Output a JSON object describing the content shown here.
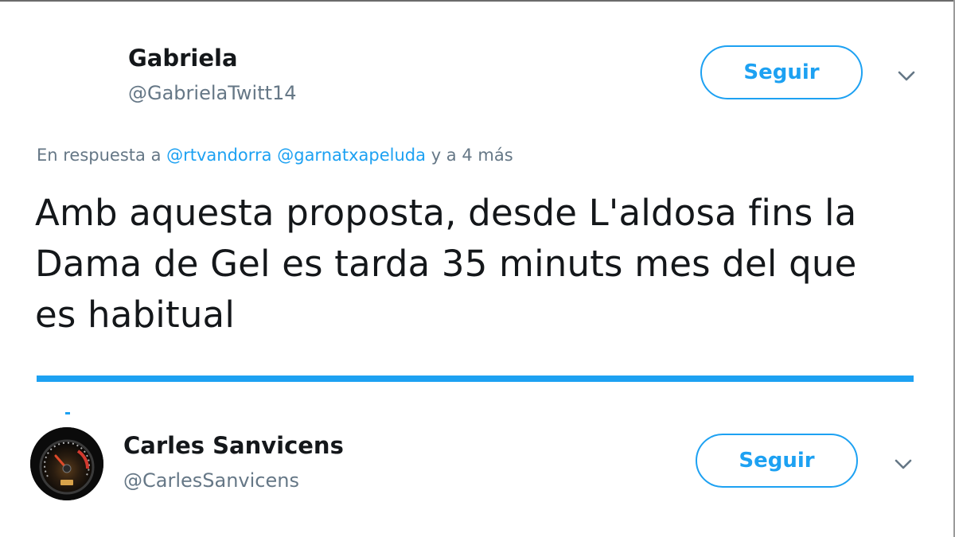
{
  "tweet1": {
    "display_name": "Gabriela",
    "handle": "@GabrielaTwitt14",
    "follow_label": "Seguir",
    "reply_prefix": "En respuesta a",
    "reply_mention_1": "@rtvandorra",
    "reply_mention_2": "@garnatxapeluda",
    "reply_suffix": "y a 4 más",
    "text_line_1": "Amb aquesta proposta, desde L'aldosa fins la",
    "text_line_2": "Dama de Gel es tarda 35 minuts mes del que",
    "text_line_3": "es habitual"
  },
  "tweet2": {
    "display_name": "Carles Sanvicens",
    "handle": "@CarlesSanvicens",
    "follow_label": "Seguir",
    "avatar_icon": "speedometer-avatar"
  },
  "colors": {
    "accent": "#1da1f2",
    "text": "#14171a",
    "muted": "#657786"
  }
}
